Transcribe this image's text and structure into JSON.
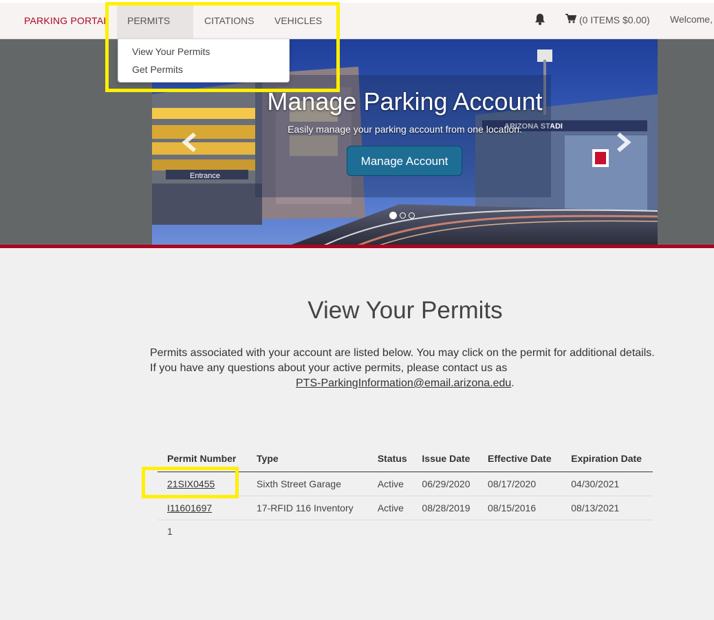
{
  "nav": {
    "brand": "PARKING PORTAL",
    "items": [
      {
        "label": "PERMITS"
      },
      {
        "label": "CITATIONS"
      },
      {
        "label": "VEHICLES"
      }
    ],
    "cart": "(0 ITEMS $0.00)",
    "welcome": "Welcome,"
  },
  "dropdown": {
    "items": [
      {
        "label": "View Your Permits"
      },
      {
        "label": "Get Permits"
      }
    ]
  },
  "hero": {
    "title": "Manage Parking Account",
    "subtitle": "Easily manage your parking account from one location.",
    "button": "Manage Account",
    "image_signs": {
      "entrance": "Entrance",
      "stadium": "ARIZONA STADI"
    }
  },
  "page": {
    "title": "View Your Permits",
    "intro_line1": "Permits associated with your account are listed below. You may click on the permit for additional details.",
    "intro_line2": "If you have any questions about your active permits, please contact us as",
    "email": "PTS-ParkingInformation@email.arizona.edu",
    "email_suffix": "."
  },
  "table": {
    "headers": [
      "Permit Number",
      "Type",
      "Status",
      "Issue Date",
      "Effective Date",
      "Expiration Date"
    ],
    "rows": [
      [
        "21SIX0455",
        "Sixth Street Garage",
        "Active",
        "06/29/2020",
        "08/17/2020",
        "04/30/2021"
      ],
      [
        "I11601697",
        "17-RFID 116 Inventory",
        "Active",
        "08/28/2019",
        "08/15/2016",
        "08/13/2021"
      ]
    ],
    "pager": "1"
  },
  "colors": {
    "brand_red": "#ab0520",
    "button_blue": "#1e6d94",
    "highlight_yellow": "#ffef00"
  }
}
